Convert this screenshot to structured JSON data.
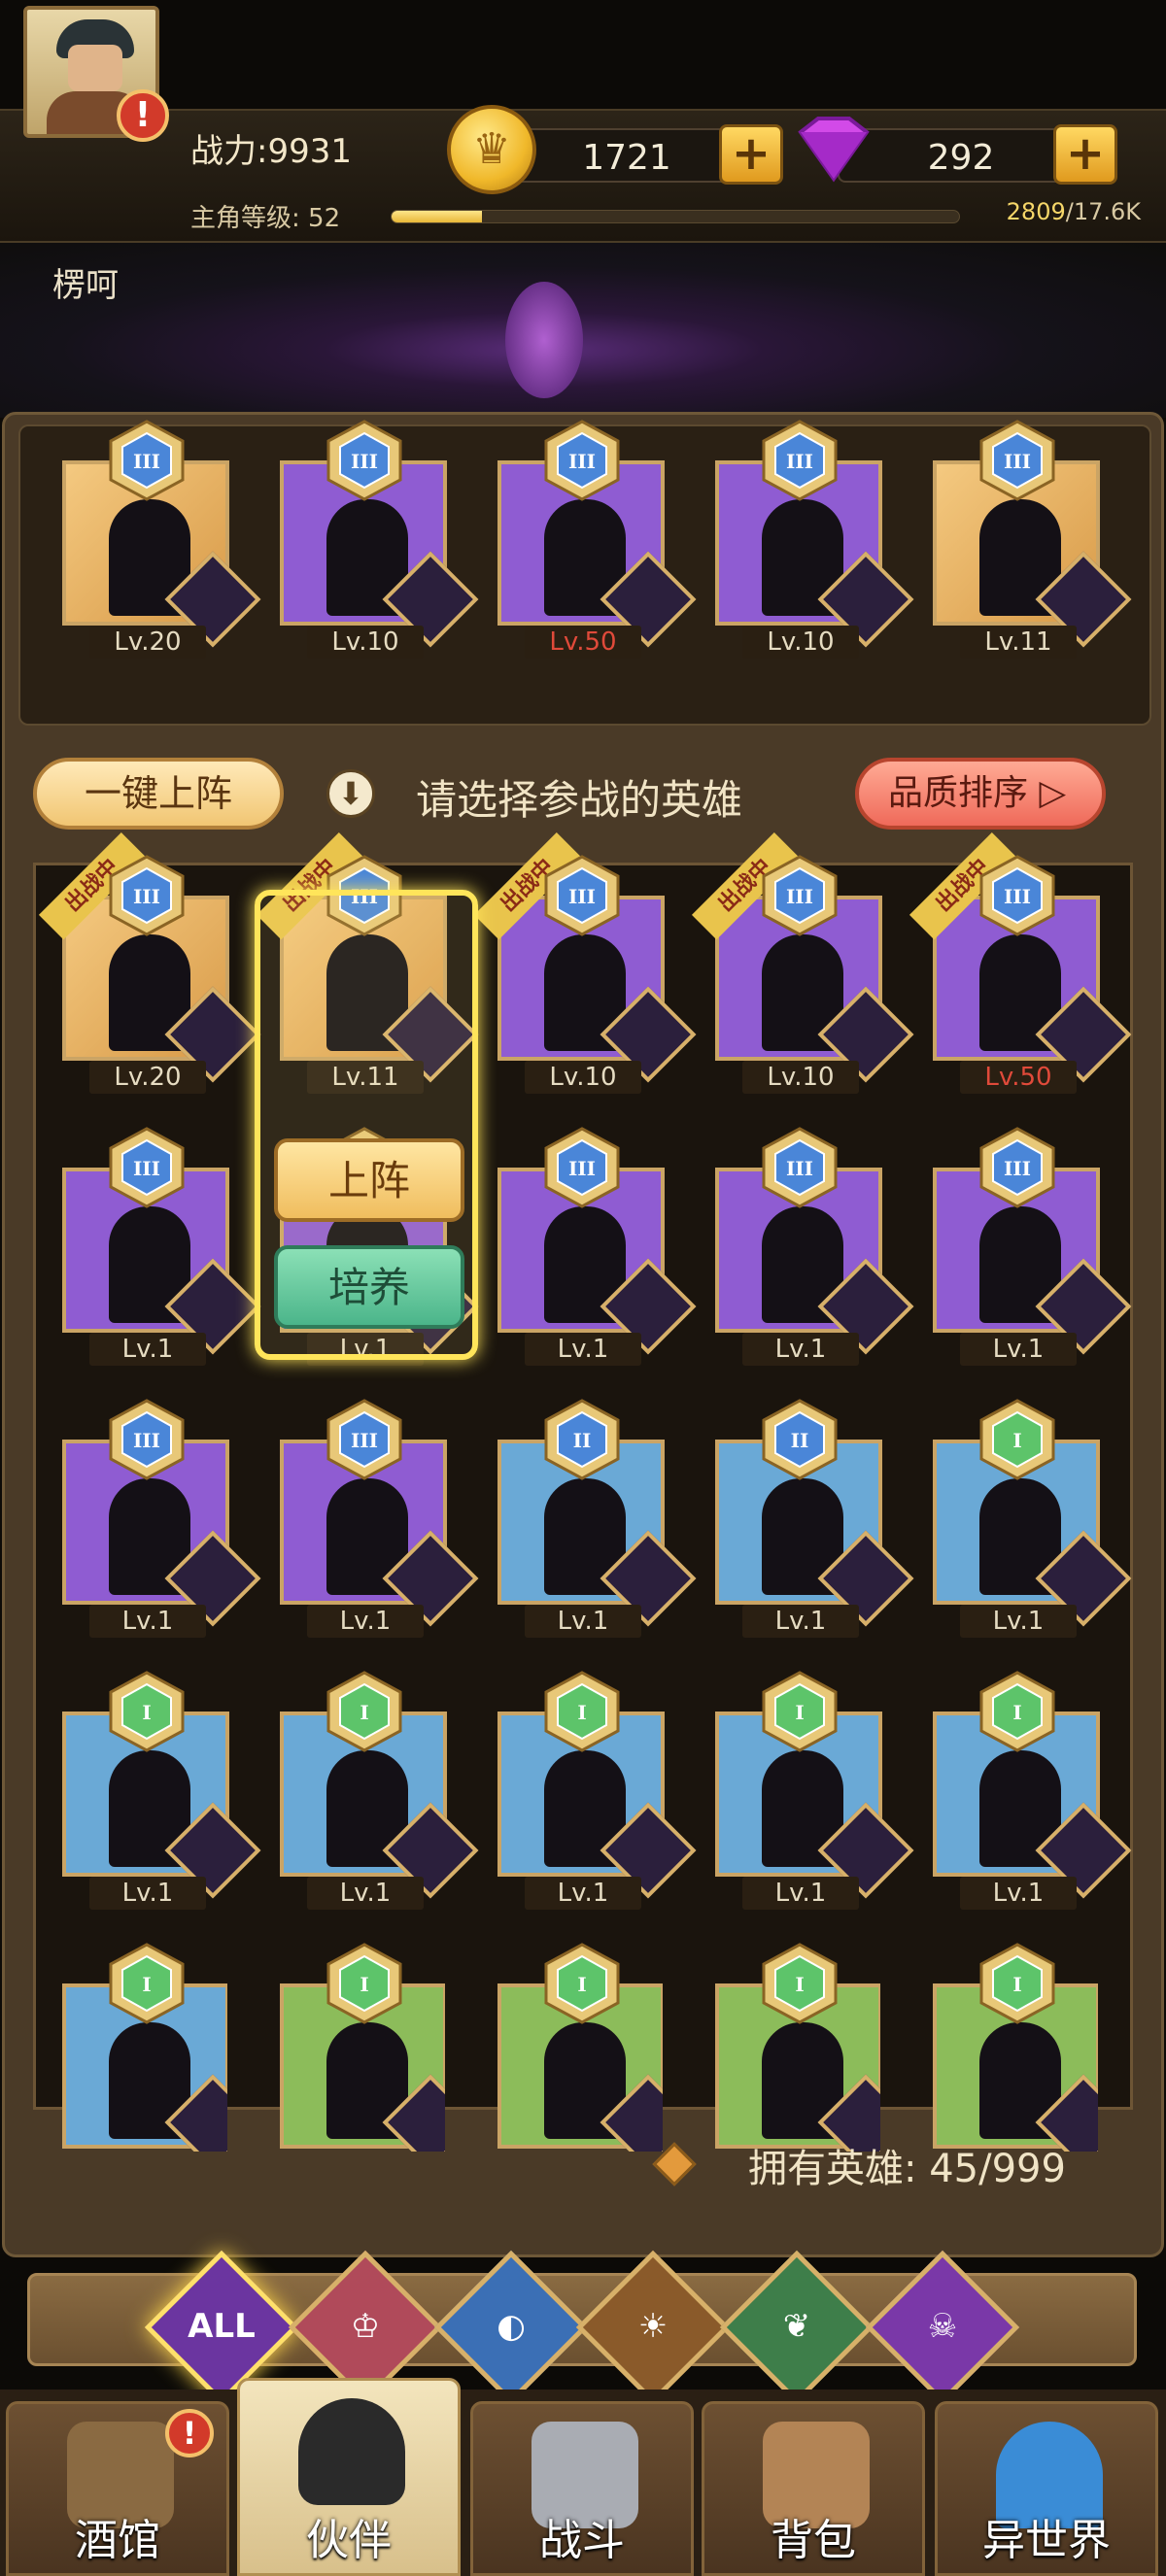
{
  "header": {
    "power": "战力:9931",
    "level_label": "主角等级: 52",
    "xp_progress": 0.16,
    "xp_current": "2809",
    "xp_total": "/17.6K",
    "gold": "1721",
    "gems": "292",
    "plus_label": "+",
    "alert_mark": "!"
  },
  "player": {
    "name": "楞呵"
  },
  "lineup": [
    {
      "level": "Lv.20",
      "rank": "III",
      "frame": "gold"
    },
    {
      "level": "Lv.10",
      "rank": "III",
      "frame": "purple"
    },
    {
      "level": "Lv.50",
      "rank": "III",
      "frame": "purple",
      "highlight": true
    },
    {
      "level": "Lv.10",
      "rank": "III",
      "frame": "purple"
    },
    {
      "level": "Lv.11",
      "rank": "III",
      "frame": "gold"
    }
  ],
  "controls": {
    "one_key": "一键上阵",
    "hint": "请选择参战的英雄",
    "sort": "品质排序"
  },
  "roster": {
    "deployed_tag": "出战中",
    "rows": [
      [
        {
          "level": "Lv.20",
          "rank": "III",
          "frame": "gold",
          "tag": true
        },
        {
          "level": "Lv.11",
          "rank": "III",
          "frame": "gold",
          "tag": true
        },
        {
          "level": "Lv.10",
          "rank": "III",
          "frame": "purple",
          "tag": true
        },
        {
          "level": "Lv.10",
          "rank": "III",
          "frame": "purple",
          "tag": true
        },
        {
          "level": "Lv.50",
          "rank": "III",
          "frame": "purple",
          "tag": true,
          "red": true
        }
      ],
      [
        {
          "level": "Lv.1",
          "rank": "III",
          "frame": "purple"
        },
        {
          "level": "Lv.1",
          "rank": "III",
          "frame": "purple"
        },
        {
          "level": "Lv.1",
          "rank": "III",
          "frame": "purple"
        },
        {
          "level": "Lv.1",
          "rank": "III",
          "frame": "purple"
        },
        {
          "level": "Lv.1",
          "rank": "III",
          "frame": "purple"
        }
      ],
      [
        {
          "level": "Lv.1",
          "rank": "III",
          "frame": "purple"
        },
        {
          "level": "Lv.1",
          "rank": "III",
          "frame": "purple"
        },
        {
          "level": "Lv.1",
          "rank": "II",
          "frame": "blue"
        },
        {
          "level": "Lv.1",
          "rank": "II",
          "frame": "blue"
        },
        {
          "level": "Lv.1",
          "rank": "I",
          "frame": "blue"
        }
      ],
      [
        {
          "level": "Lv.1",
          "rank": "I",
          "frame": "blue"
        },
        {
          "level": "Lv.1",
          "rank": "I",
          "frame": "blue"
        },
        {
          "level": "Lv.1",
          "rank": "I",
          "frame": "blue"
        },
        {
          "level": "Lv.1",
          "rank": "I",
          "frame": "blue"
        },
        {
          "level": "Lv.1",
          "rank": "I",
          "frame": "blue"
        }
      ],
      [
        {
          "level": "",
          "rank": "I",
          "frame": "blue"
        },
        {
          "level": "",
          "rank": "I",
          "frame": "green"
        },
        {
          "level": "",
          "rank": "I",
          "frame": "green"
        },
        {
          "level": "",
          "rank": "I",
          "frame": "green"
        },
        {
          "level": "",
          "rank": "I",
          "frame": "green"
        }
      ]
    ],
    "popup": {
      "deploy": "上阵",
      "train": "培养"
    }
  },
  "owned": {
    "label": "拥有英雄: 45/999"
  },
  "filters": {
    "all": "ALL"
  },
  "nav": {
    "tavern": "酒馆",
    "partner": "伙伴",
    "battle": "战斗",
    "bag": "背包",
    "world": "异世界"
  },
  "colors": {
    "accent_gold": "#ffd862",
    "select_glow": "#ffe55a",
    "danger": "#d23a2a"
  }
}
